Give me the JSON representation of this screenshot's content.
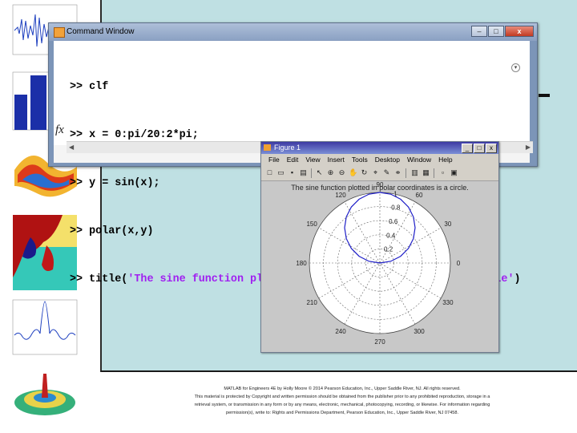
{
  "command_window": {
    "title": "Command Window",
    "prompt": ">>",
    "lines": [
      {
        "code": "clf",
        "string": ""
      },
      {
        "code": "x = 0:pi/20:2*pi;",
        "string": ""
      },
      {
        "code": "y = sin(x);",
        "string": ""
      },
      {
        "code": "polar(x,y)",
        "string": ""
      },
      {
        "code": "title(",
        "string": "'The sine function plotted in polar coordinates is a circle'",
        "suffix": ")"
      }
    ],
    "fx_label": "fx",
    "window_buttons": {
      "minimize": "–",
      "maximize": "□",
      "close": "x"
    }
  },
  "figure_window": {
    "title": "Figure 1",
    "menus": [
      "File",
      "Edit",
      "View",
      "Insert",
      "Tools",
      "Desktop",
      "Window",
      "Help"
    ],
    "toolbar_icons": [
      "new-icon",
      "open-icon",
      "save-icon",
      "print-icon",
      "arrow-icon",
      "zoom-in-icon",
      "zoom-out-icon",
      "pan-icon",
      "rotate-icon",
      "datacursor-icon",
      "brush-icon",
      "link-icon",
      "colorbar-icon",
      "legend-icon",
      "hide-tools-icon",
      "show-tools-icon"
    ],
    "window_buttons": {
      "minimize": "_",
      "maximize": "□",
      "close": "x"
    }
  },
  "chart_data": {
    "type": "line",
    "title": "The sine function plotted in polar coordinates is a circle.",
    "coordinate_system": "polar",
    "angle_labels": [
      "0",
      "30",
      "60",
      "90",
      "120",
      "150",
      "180",
      "210",
      "240",
      "270",
      "300",
      "330"
    ],
    "radial_labels": [
      "0.2",
      "0.4",
      "0.6",
      "0.8",
      "1"
    ],
    "rmax": 1,
    "series": [
      {
        "expression": "r = sin(theta), theta = 0:pi/20:2*pi",
        "color": "#1f1fc8"
      }
    ]
  },
  "footer": {
    "line1": "MATLAB for Engineers 4E by Holly Moore © 2014 Pearson Education, Inc., Upper Saddle River, NJ. All rights reserved.",
    "line2": "This material is protected by Copyright and written permission should be obtained from the publisher prior to any prohibited reproduction, storage in a",
    "line3": "retrieval system, or transmission in any form or by any means, electronic, mechanical, photocopying, recording, or likewise. For information regarding",
    "line4": "permission(s), write to: Rights and Permissions Department, Pearson Education, Inc., Upper Saddle River, NJ 07458."
  },
  "colors": {
    "slide_background": "#bfe0e3",
    "code_string": "#a020f0",
    "plot_line": "#1f1fc8"
  }
}
